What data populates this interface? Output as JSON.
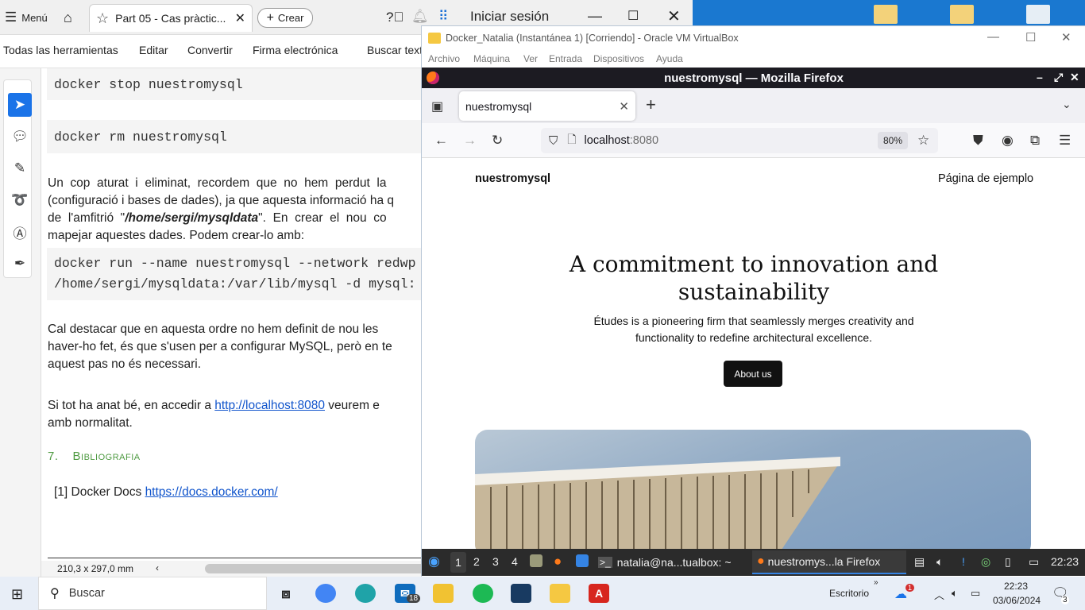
{
  "acrobat": {
    "menu_label": "Menú",
    "tab_title": "Part 05 - Cas pràctic...",
    "create_label": "Crear",
    "signin_label": "Iniciar sesión",
    "toolbar": [
      "Todas las herramientas",
      "Editar",
      "Convertir",
      "Firma electrónica",
      "Buscar text"
    ],
    "status_dims": "210,3 x 297,0 mm"
  },
  "doc": {
    "code_stop": "docker stop nuestromysql",
    "code_rm": "docker rm nuestromysql",
    "p1_l1": "Un  cop  aturat  i  eliminat,  recordem  que  no  hem  perdut  la",
    "p1_l2": "(configuració i bases de dades), ja que aquesta informació ha q",
    "p1_l3_a": "de  l'amfitrió  \"",
    "p1_l3_b": "/home/sergi/mysqldata",
    "p1_l3_c": "\".  En  crear  el  nou  co",
    "p1_l4": "mapejar aquestes dades. Podem crear-lo amb:",
    "code_run_l1": "docker run --name nuestromysql --network redwp",
    "code_run_l2": "/home/sergi/mysqldata:/var/lib/mysql -d mysql:",
    "p2_l1": "Cal destacar que en aquesta ordre no hem definit de nou les",
    "p2_l2": "haver-ho fet, és que s'usen per a configurar MySQL, però en te",
    "p2_l3": "aquest pas no és necessari.",
    "p3_a": "Si tot ha anat bé, en accedir a ",
    "p3_link": "http://localhost:8080",
    "p3_b": " veurem e",
    "p3_l2": "amb normalitat.",
    "sec_num": "7.",
    "sec_title": "Bibliografia",
    "ref_a": "[1] Docker Docs ",
    "ref_link": "https://docs.docker.com/"
  },
  "vbox": {
    "title": "Docker_Natalia (Instantánea 1) [Corriendo] - Oracle VM VirtualBox",
    "menu": [
      "Archivo",
      "Máquina",
      "Ver",
      "Entrada",
      "Dispositivos",
      "Ayuda"
    ]
  },
  "firefox": {
    "window_title": "nuestromysql — Mozilla Firefox",
    "tab_title": "nuestromysql",
    "url_host": "localhost",
    "url_port": ":8080",
    "zoom": "80%"
  },
  "site": {
    "title": "nuestromysql",
    "nav": "Página de ejemplo",
    "heading_l1": "A commitment to innovation and",
    "heading_l2": "sustainability",
    "text_l1": "Études is a pioneering firm that seamlessly merges creativity and",
    "text_l2": "functionality to redefine architectural excellence.",
    "button": "About us"
  },
  "xfce": {
    "workspaces": [
      "1",
      "2",
      "3",
      "4"
    ],
    "term_task": "natalia@na...tualbox: ~",
    "ff_task": "nuestromys...la Firefox",
    "clock": "22:23"
  },
  "taskbar": {
    "search": "Buscar",
    "mail_badge": "18",
    "desktop_label": "Escritorio",
    "cloud_badge": "1",
    "time": "22:23",
    "date": "03/06/2024",
    "notif_count": "3"
  }
}
